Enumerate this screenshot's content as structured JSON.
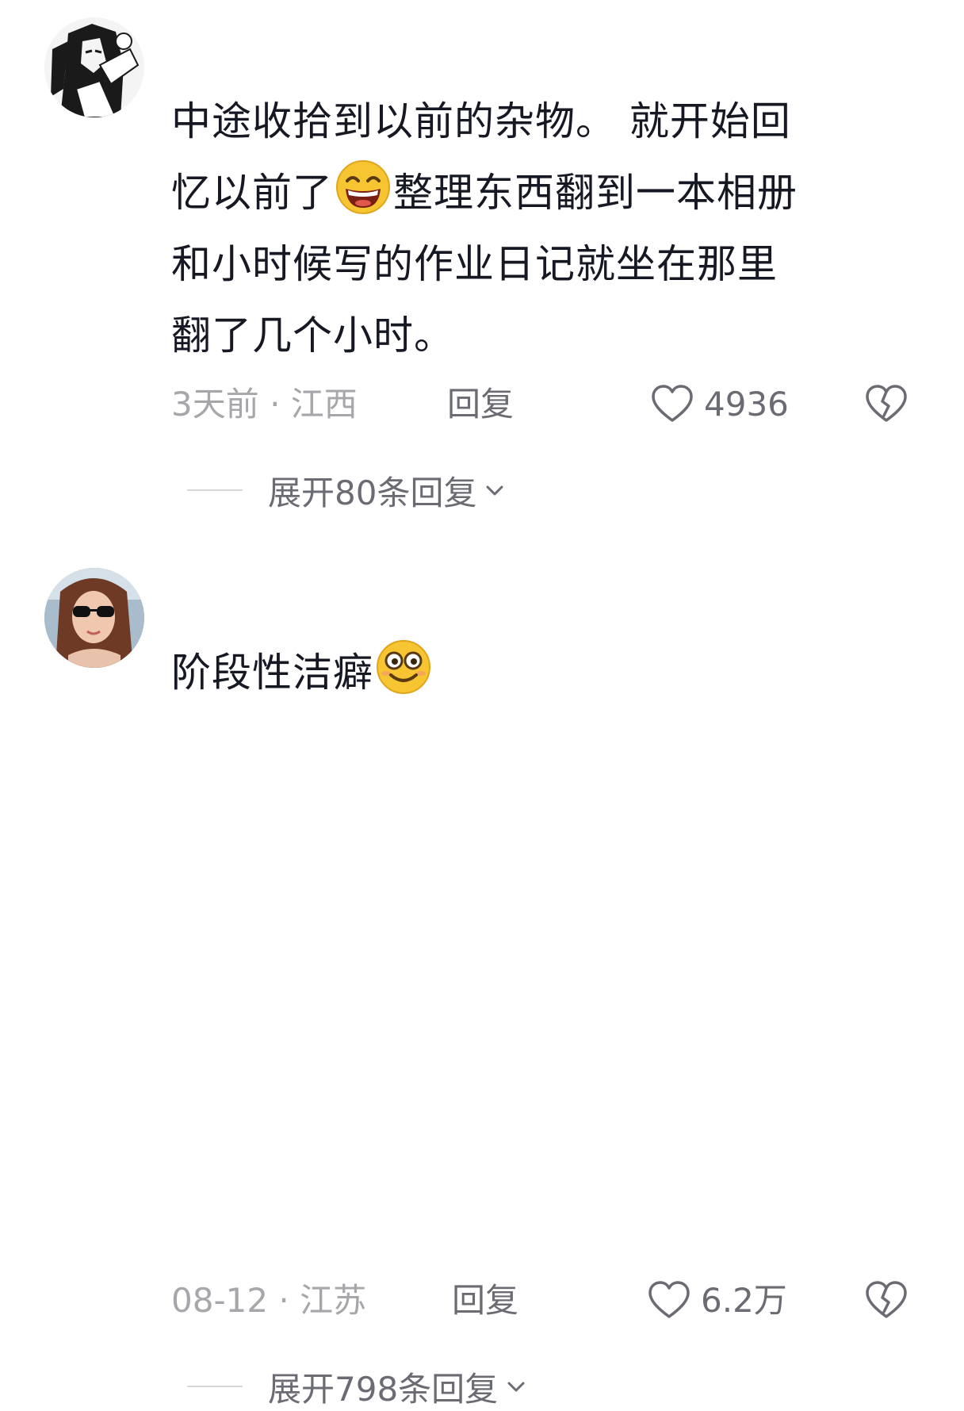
{
  "comments": [
    {
      "lines": [
        [
          "中途收拾到以前的杂物。 就开始回"
        ],
        [
          "忆以前了",
          "整理东西翻到一本相册"
        ],
        [
          "和小时候写的作业日记就坐在那里"
        ],
        [
          "翻了几个小时。"
        ]
      ],
      "line_text": [
        "中途收拾到以前的杂物。 就开始回",
        "忆以前了",
        "整理东西翻到一本相册",
        "和小时候写的作业日记就坐在那里",
        "翻了几个小时。"
      ],
      "emoji": "grinning-squint-emoji",
      "time": "3天前 · 江西",
      "reply_label": "回复",
      "likes": "4936",
      "expand_label": "展开80条回复"
    },
    {
      "line_text": [
        "阶段性洁癖"
      ],
      "emoji": "wide-eyed-smile-emoji",
      "time": "08-12 · 江苏",
      "reply_label": "回复",
      "likes": "6.2万",
      "expand_label": "展开798条回复"
    }
  ],
  "colors": {
    "primary_text": "#161823",
    "secondary_text": "#a6a6ab",
    "action_text": "#6b6c73",
    "emoji_yellow": "#f7c531"
  }
}
